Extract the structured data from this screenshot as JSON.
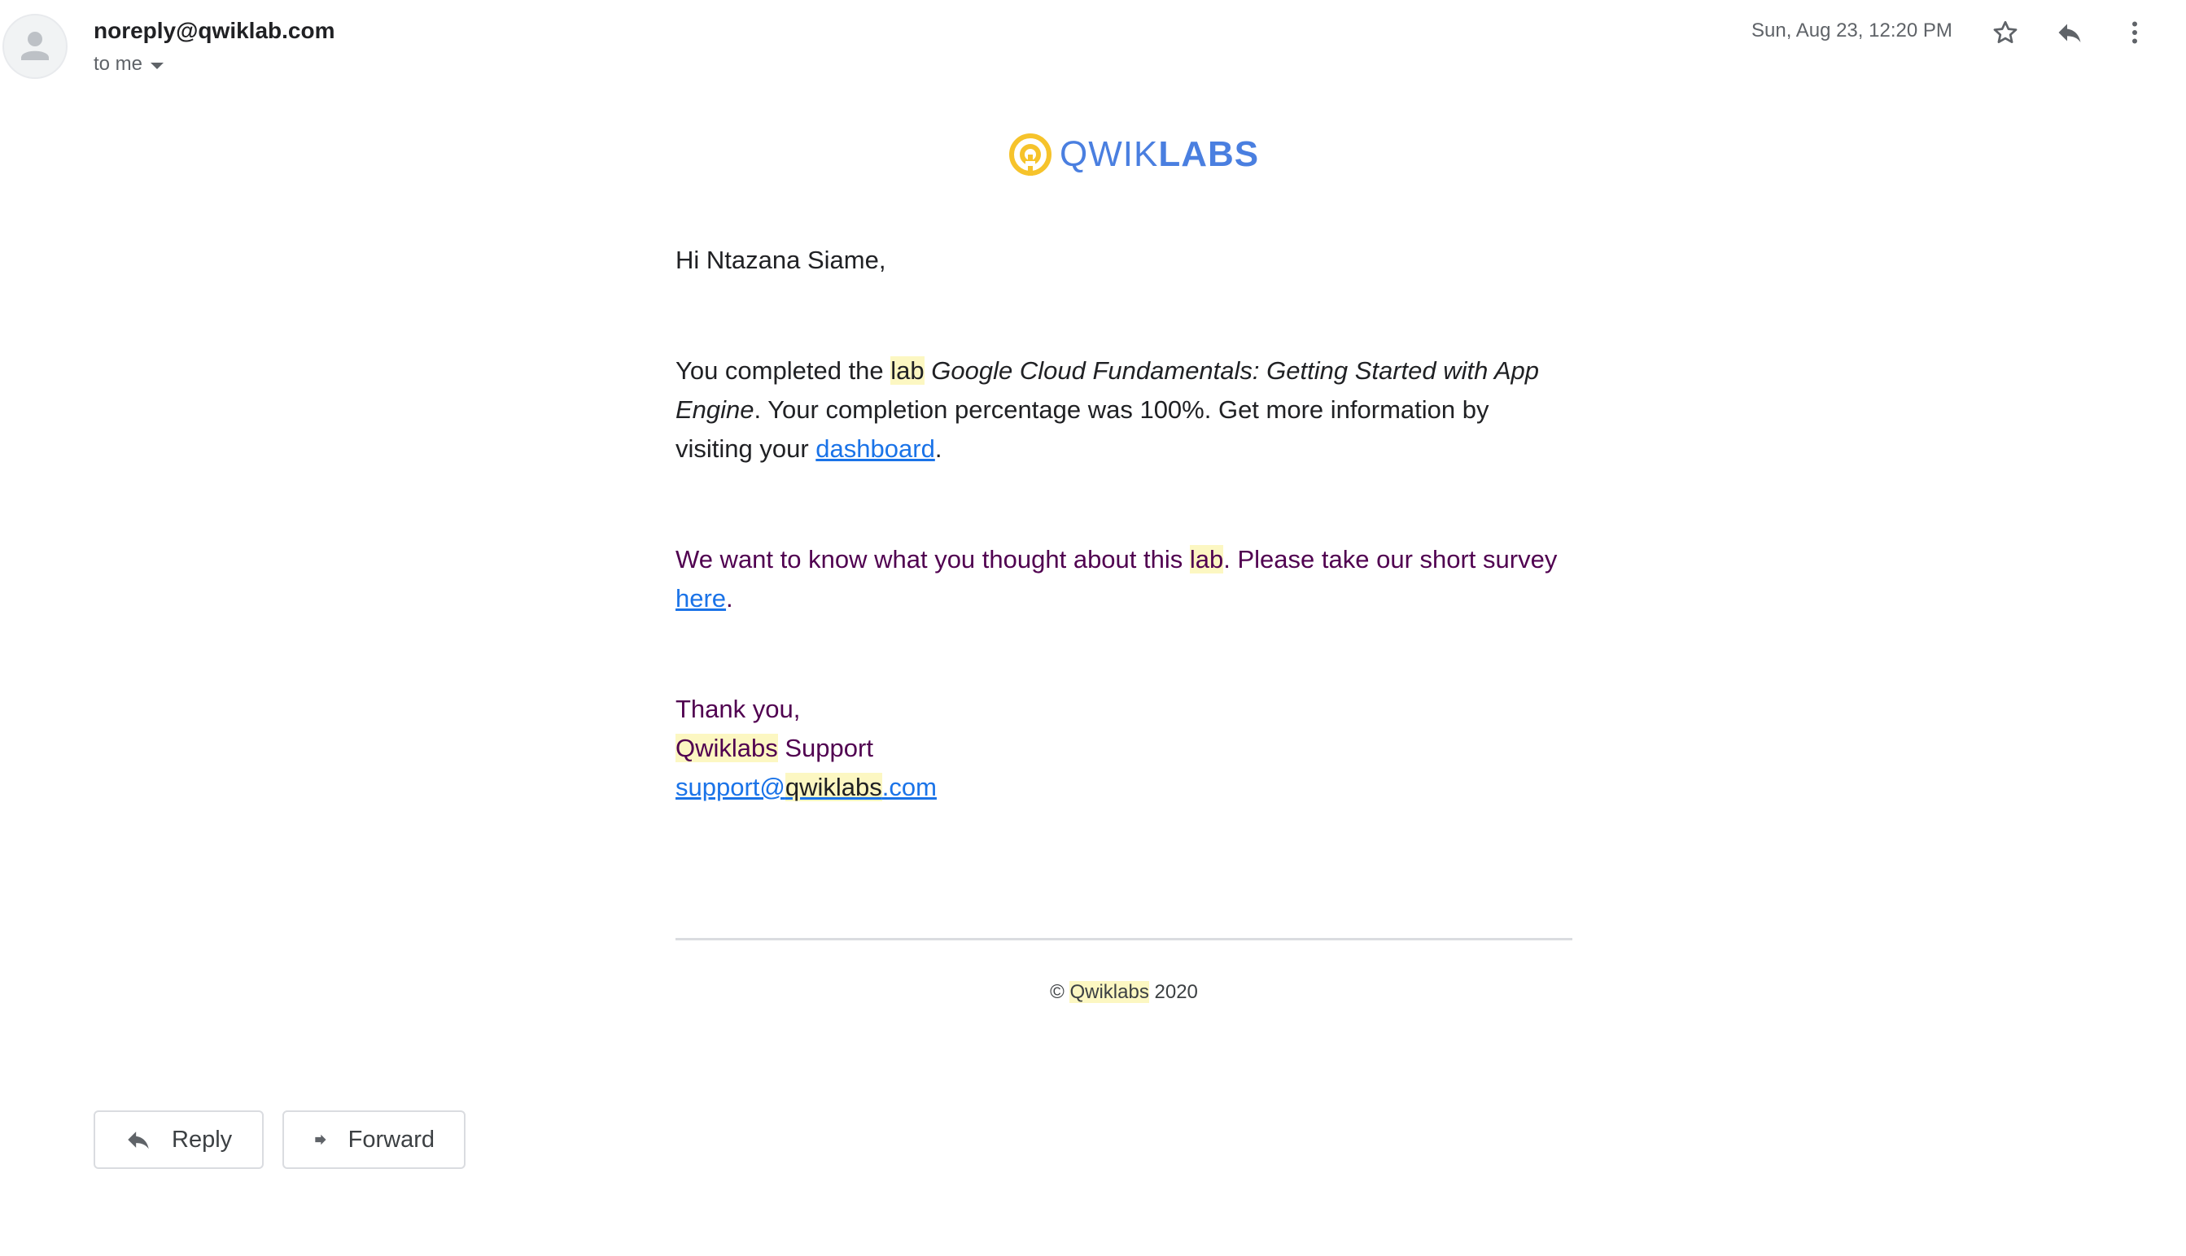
{
  "header": {
    "sender": "noreply@qwiklab.com",
    "recipient_label": "to me",
    "date": "Sun, Aug 23, 12:20 PM",
    "icons": [
      "avatar-icon",
      "star-icon",
      "reply-icon",
      "more-vert-icon"
    ]
  },
  "logo": {
    "text_light": "QWIK",
    "text_bold": "LABS",
    "brand_yellow": "#f6c32b",
    "brand_blue": "#4a7fe0"
  },
  "body": {
    "greeting": "Hi Ntazana Siame,",
    "p1_start": "You completed the ",
    "p1_lab": "lab",
    "p1_lab_title": "Google Cloud Fundamentals: Getting Started with App Engine",
    "p1_mid": ". Your completion percentage was 100%. Get more information by visiting your ",
    "p1_link": "dashboard",
    "p1_end": ".",
    "p2_start": "We want to know what you thought about this ",
    "p2_lab": "lab",
    "p2_mid": ". Please take our short survey ",
    "p2_link": "here",
    "p2_end": ".",
    "thanks": "Thank you,",
    "sig_brand": "Qwiklabs",
    "sig_support": " Support",
    "email_a": "support@",
    "email_b": "qwiklabs",
    "email_c": ".com"
  },
  "footer": {
    "copy_symbol": "©",
    "brand": "Qwiklabs",
    "year": "2020"
  },
  "actions": {
    "reply_label": "Reply",
    "forward_label": "Forward"
  },
  "colors": {
    "link": "#1a73e8",
    "quoted_text": "#500050",
    "highlight": "#fcf7c2"
  }
}
